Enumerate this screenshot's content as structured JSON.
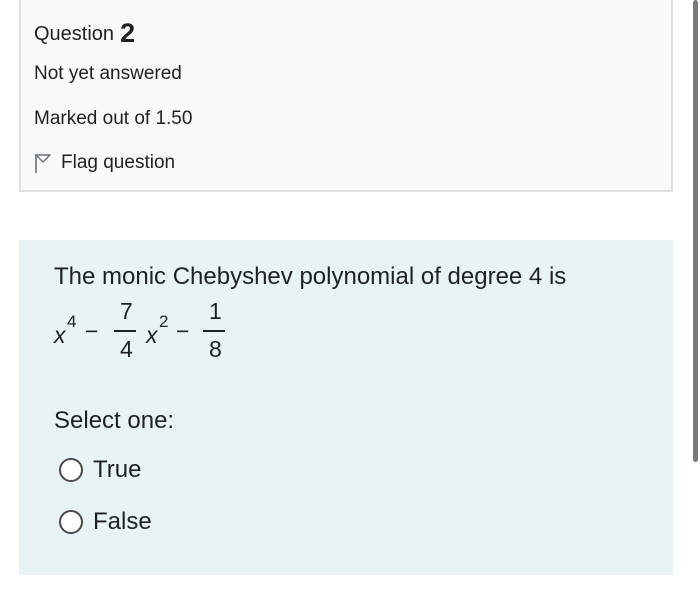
{
  "question_info": {
    "label": "Question",
    "number": "2",
    "state": "Not yet answered",
    "grade": "Marked out of 1.50",
    "flag_label": "Flag question",
    "flag_icon": "flag-icon"
  },
  "content": {
    "question_text": "The monic Chebyshev polynomial of degree 4 is",
    "formula": {
      "term1_base": "x",
      "term1_exp": "4",
      "minus1": "−",
      "frac1_num": "7",
      "frac1_den": "4",
      "term2_base": "x",
      "term2_exp": "2",
      "minus2": "−",
      "frac2_num": "1",
      "frac2_den": "8"
    },
    "prompt": "Select one:",
    "options": [
      {
        "label": "True",
        "selected": false
      },
      {
        "label": "False",
        "selected": false
      }
    ]
  },
  "colors": {
    "info_background": "#f8f9fa",
    "content_background": "#e7f3f5",
    "text": "#1d2125"
  }
}
